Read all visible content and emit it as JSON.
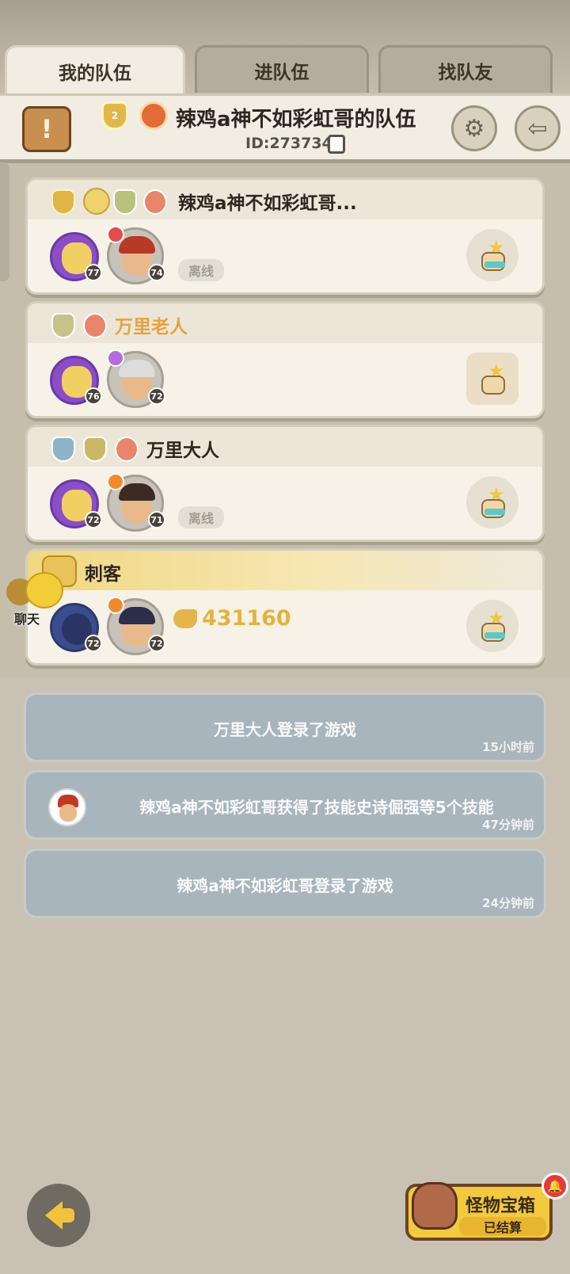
{
  "tabs": {
    "my_team": "我的队伍",
    "join_team": "进队伍",
    "find_teammate": "找队友"
  },
  "team": {
    "title": "辣鸡a神不如彩虹哥的队伍",
    "id_text": "ID:273734",
    "badge_level": "2"
  },
  "members": [
    {
      "name": "辣鸡a神不如彩虹哥...",
      "pet_level": "77",
      "hero_level": "74",
      "status": "离线",
      "badge_levels": [
        "3",
        "3"
      ],
      "name_color": "#2e2620"
    },
    {
      "name": "万里老人",
      "pet_level": "76",
      "hero_level": "72",
      "status": "",
      "badge_levels": [],
      "name_color": "#e6a23c"
    },
    {
      "name": "万里大人",
      "pet_level": "72",
      "hero_level": "71",
      "status": "离线",
      "badge_levels": [
        "1",
        "3"
      ],
      "name_color": "#2e2620"
    },
    {
      "name": "刺客",
      "pet_level": "72",
      "hero_level": "72",
      "power": "431160",
      "status": "",
      "name_color": "#2e2620"
    }
  ],
  "chat_label": "聊天",
  "logs": [
    {
      "msg": "万里大人登录了游戏",
      "time": "15小时前"
    },
    {
      "msg": "辣鸡a神不如彩虹哥获得了技能史诗倔强等5个技能",
      "time": "47分钟前"
    },
    {
      "msg": "辣鸡a神不如彩虹哥登录了游戏",
      "time": "24分钟前"
    }
  ],
  "chest": {
    "title": "怪物宝箱",
    "status": "已结算"
  },
  "colors": {
    "accent_gold": "#e3b33f",
    "log_bg": "#a9b5bc",
    "panel_bg": "#f6f2e8"
  }
}
